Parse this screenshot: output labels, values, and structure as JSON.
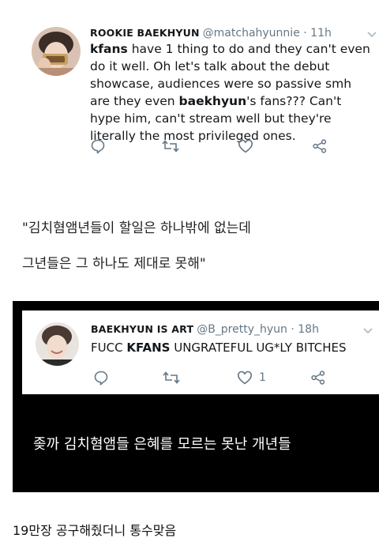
{
  "tweet1": {
    "display_name": "ROOKIE BAEKHYUN",
    "handle_time": "@matchahyunnie · 11h",
    "text_parts": [
      {
        "t": "kfans",
        "b": true
      },
      {
        "t": " have 1 thing to do and they can't even do it well. Oh let's talk about the debut showcase, audiences were so passive smh are they even ",
        "b": false
      },
      {
        "t": "baekhyun",
        "b": true
      },
      {
        "t": "'s fans??? Can't hype him, can't stream well but they're literally the most privileged ones.",
        "b": false
      }
    ],
    "icons": [
      "reply-icon",
      "retweet-icon",
      "like-icon",
      "share-icon"
    ]
  },
  "quote_lines": [
    "\"김치혐앰년들이 할일은 하나밖에 없는데",
    "그년들은 그 하나도 제대로 못해\""
  ],
  "tweet2": {
    "display_name": "BAEKHYUN IS ART",
    "handle_time": "@B_pretty_hyun · 18h",
    "text_parts": [
      {
        "t": "FUCC ",
        "b": false
      },
      {
        "t": "KFANS",
        "b": true
      },
      {
        "t": " UNGRATEFUL UG*LY BITCHES",
        "b": false
      }
    ],
    "like_count": "1",
    "icons": [
      "reply-icon",
      "retweet-icon",
      "like-icon",
      "share-icon"
    ]
  },
  "subtitle": "좆까 김치혐앰들 은혜를 모르는 못난 개년들",
  "caption": "19만장 공구해줬더니 통수맞음",
  "colors": {
    "icon_gray": "#657786",
    "text": "#14171a",
    "dark_bg": "#000000"
  }
}
